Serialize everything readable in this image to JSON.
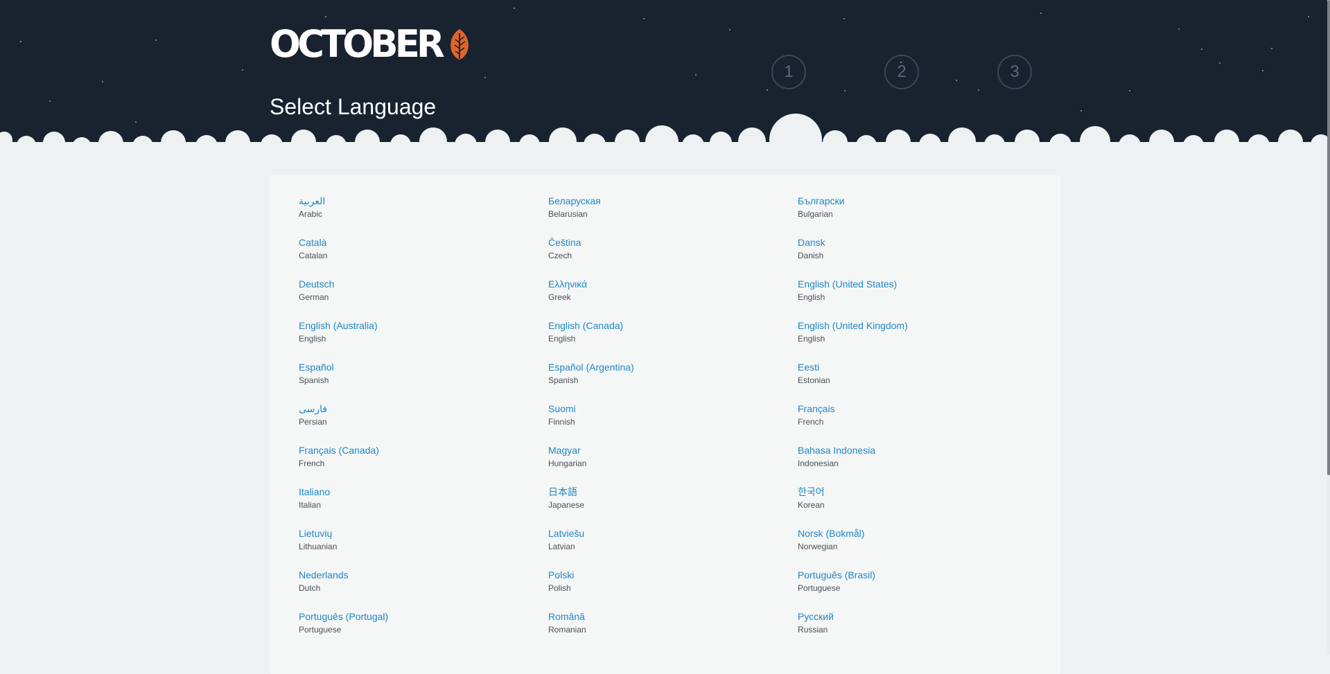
{
  "app": {
    "logo_text": "OCTOBER",
    "logo_icon": "leaf-icon",
    "title": "Select Language"
  },
  "steps": [
    "1",
    "2",
    "3"
  ],
  "colors": {
    "header_bg": "#18232f",
    "page_bg": "#eef1f2",
    "panel_bg": "#f5f7f7",
    "link": "#1f86c4",
    "leaf": "#e0652b"
  },
  "languages": [
    {
      "native": "العربية",
      "english": "Arabic"
    },
    {
      "native": "Беларуская",
      "english": "Belarusian"
    },
    {
      "native": "Български",
      "english": "Bulgarian"
    },
    {
      "native": "Català",
      "english": "Catalan"
    },
    {
      "native": "Čeština",
      "english": "Czech"
    },
    {
      "native": "Dansk",
      "english": "Danish"
    },
    {
      "native": "Deutsch",
      "english": "German"
    },
    {
      "native": "Ελληνικά",
      "english": "Greek"
    },
    {
      "native": "English (United States)",
      "english": "English"
    },
    {
      "native": "English (Australia)",
      "english": "English"
    },
    {
      "native": "English (Canada)",
      "english": "English"
    },
    {
      "native": "English (United Kingdom)",
      "english": "English"
    },
    {
      "native": "Español",
      "english": "Spanish"
    },
    {
      "native": "Español (Argentina)",
      "english": "Spanish"
    },
    {
      "native": "Eesti",
      "english": "Estonian"
    },
    {
      "native": "فارسی",
      "english": "Persian"
    },
    {
      "native": "Suomi",
      "english": "Finnish"
    },
    {
      "native": "Français",
      "english": "French"
    },
    {
      "native": "Français (Canada)",
      "english": "French"
    },
    {
      "native": "Magyar",
      "english": "Hungarian"
    },
    {
      "native": "Bahasa Indonesia",
      "english": "Indonesian"
    },
    {
      "native": "Italiano",
      "english": "Italian"
    },
    {
      "native": "日本語",
      "english": "Japanese"
    },
    {
      "native": "한국어",
      "english": "Korean"
    },
    {
      "native": "Lietuvių",
      "english": "Lithuanian"
    },
    {
      "native": "Latviešu",
      "english": "Latvian"
    },
    {
      "native": "Norsk (Bokmål)",
      "english": "Norwegian"
    },
    {
      "native": "Nederlands",
      "english": "Dutch"
    },
    {
      "native": "Polski",
      "english": "Polish"
    },
    {
      "native": "Português (Brasil)",
      "english": "Portuguese"
    },
    {
      "native": "Português (Portugal)",
      "english": "Portuguese"
    },
    {
      "native": "Română",
      "english": "Romanian"
    },
    {
      "native": "Русский",
      "english": "Russian"
    }
  ]
}
